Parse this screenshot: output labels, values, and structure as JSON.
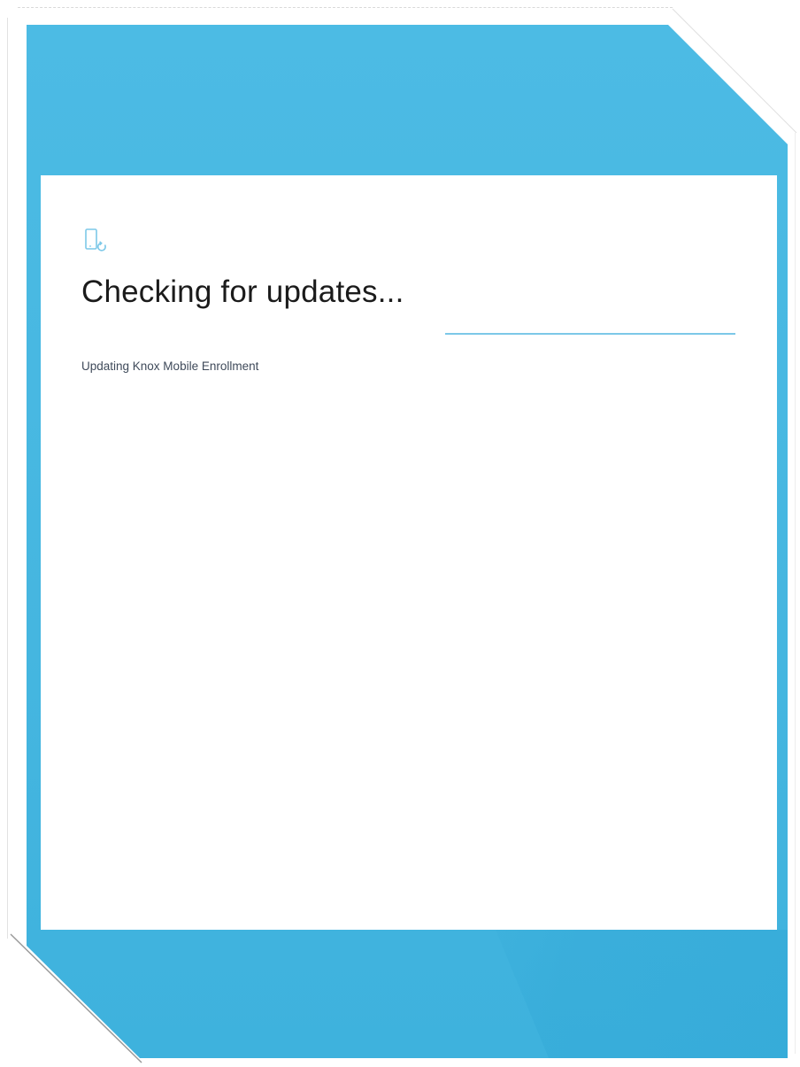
{
  "screen": {
    "icon": "phone-refresh-icon",
    "title": "Checking for updates...",
    "status_text": "Updating Knox Mobile Enrollment",
    "progress_fraction": 1.0
  },
  "colors": {
    "frame_blue": "#45b6e0",
    "screen_background": "#ffffff",
    "title_text": "#1b1b1b",
    "status_text": "#3f4a5a",
    "icon_blue": "#7cc8e8",
    "progress_line": "#7cc8e8"
  }
}
